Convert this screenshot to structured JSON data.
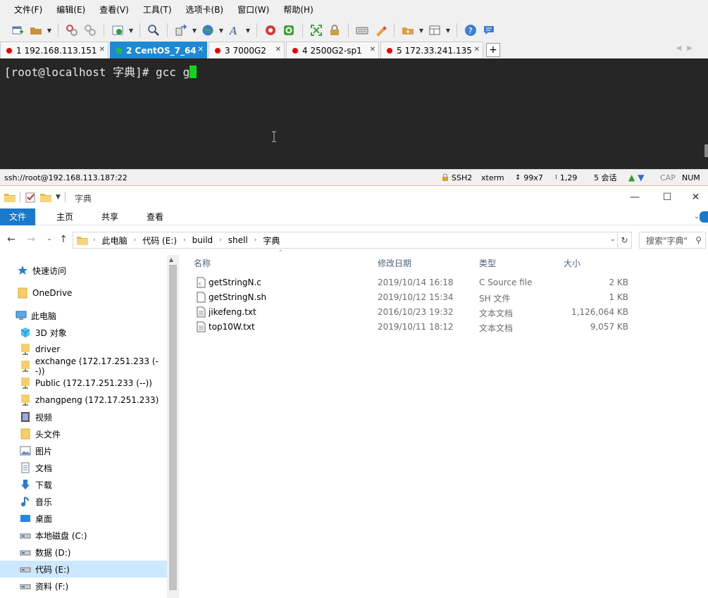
{
  "xshell": {
    "menu": [
      "文件(F)",
      "编辑(E)",
      "查看(V)",
      "工具(T)",
      "选项卡(B)",
      "窗口(W)",
      "帮助(H)"
    ],
    "tabs": [
      {
        "label": "1 192.168.113.151",
        "active": false
      },
      {
        "label": "2 CentOS_7_64",
        "active": true
      },
      {
        "label": "3 7000G2",
        "active": false
      },
      {
        "label": "4 2500G2-sp1",
        "active": false
      },
      {
        "label": "5 172.33.241.135",
        "active": false
      }
    ],
    "tab_add": "+",
    "terminal": {
      "prompt": "[root@localhost 字典]# ",
      "command": "gcc g"
    },
    "status": {
      "connection": "ssh://root@192.168.113.187:22",
      "protocol": "SSH2",
      "term": "xterm",
      "size": "99x7",
      "pos": "1,29",
      "sessions": "5 会话",
      "caps": "CAP",
      "num": "NUM"
    },
    "colors": {
      "active_tab": "#1e8ad6",
      "terminal_bg": "#262626",
      "cursor": "#16d416"
    }
  },
  "explorer": {
    "title": "字典",
    "ribbon": [
      "文件",
      "主页",
      "共享",
      "查看"
    ],
    "breadcrumb": [
      "此电脑",
      "代码 (E:)",
      "build",
      "shell",
      "字典"
    ],
    "search_placeholder": "搜索\"字典\"",
    "nav": [
      {
        "label": "快速访问",
        "icon": "star-icon",
        "indent": 0
      },
      {
        "label": "OneDrive",
        "icon": "folder-icon",
        "indent": 0
      },
      {
        "label": "此电脑",
        "icon": "computer-icon",
        "indent": 0
      },
      {
        "label": "3D 对象",
        "icon": "cube-icon",
        "indent": 1
      },
      {
        "label": "driver",
        "icon": "network-folder-icon",
        "indent": 1
      },
      {
        "label": "exchange (172.17.251.233 (--))",
        "icon": "network-folder-icon",
        "indent": 1
      },
      {
        "label": "Public (172.17.251.233 (--))",
        "icon": "network-folder-icon",
        "indent": 1
      },
      {
        "label": "zhangpeng (172.17.251.233)",
        "icon": "network-folder-icon",
        "indent": 1
      },
      {
        "label": "视频",
        "icon": "video-icon",
        "indent": 1
      },
      {
        "label": "头文件",
        "icon": "folder-icon",
        "indent": 1
      },
      {
        "label": "图片",
        "icon": "picture-icon",
        "indent": 1
      },
      {
        "label": "文档",
        "icon": "document-icon",
        "indent": 1
      },
      {
        "label": "下载",
        "icon": "download-icon",
        "indent": 1
      },
      {
        "label": "音乐",
        "icon": "music-icon",
        "indent": 1
      },
      {
        "label": "桌面",
        "icon": "desktop-icon",
        "indent": 1
      },
      {
        "label": "本地磁盘 (C:)",
        "icon": "drive-icon",
        "indent": 1
      },
      {
        "label": "数据 (D:)",
        "icon": "drive-icon",
        "indent": 1
      },
      {
        "label": "代码 (E:)",
        "icon": "drive-icon",
        "indent": 1,
        "selected": true
      },
      {
        "label": "资料 (F:)",
        "icon": "drive-icon",
        "indent": 1
      }
    ],
    "columns": {
      "name": "名称",
      "date": "修改日期",
      "type": "类型",
      "size": "大小"
    },
    "files": [
      {
        "name": "getStringN.c",
        "date": "2019/10/14 16:18",
        "type": "C Source file",
        "size": "2 KB",
        "icon": "c-file-icon"
      },
      {
        "name": "getStringN.sh",
        "date": "2019/10/12 15:34",
        "type": "SH 文件",
        "size": "1 KB",
        "icon": "file-icon"
      },
      {
        "name": "jikefeng.txt",
        "date": "2016/10/23 19:32",
        "type": "文本文档",
        "size": "1,126,064 KB",
        "icon": "text-file-icon"
      },
      {
        "name": "top10W.txt",
        "date": "2019/10/11 18:12",
        "type": "文本文档",
        "size": "9,057 KB",
        "icon": "text-file-icon"
      }
    ],
    "colors": {
      "selected_nav": "#cce8ff",
      "file_tab": "#1979ca",
      "header_text": "#4c607a"
    }
  }
}
